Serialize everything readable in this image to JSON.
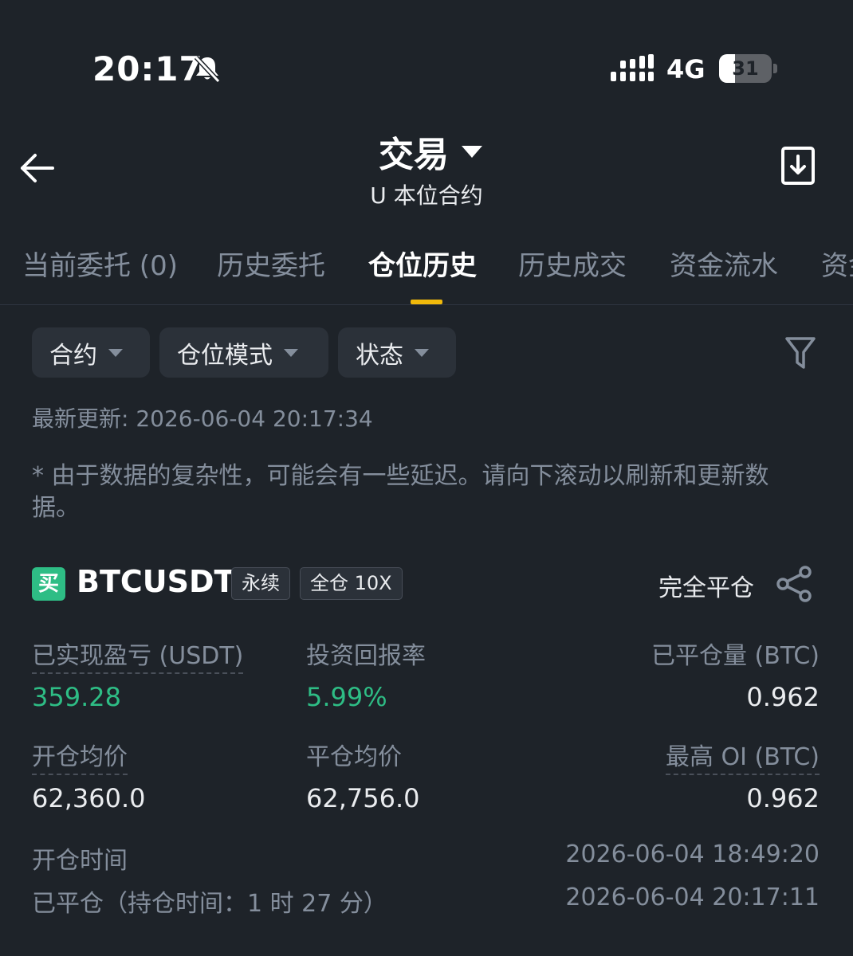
{
  "status_bar": {
    "time": "20:17",
    "network": "4G",
    "battery_level": "31",
    "battery_fraction": 0.31,
    "icons": [
      "bell-muted-icon",
      "signal-icon",
      "battery-icon"
    ]
  },
  "header": {
    "title": "交易",
    "subtitle": "U 本位合约",
    "icons": [
      "back-arrow-icon",
      "caret-down-icon",
      "download-icon"
    ]
  },
  "tabs": [
    {
      "label": "当前委托 (0)",
      "active": false
    },
    {
      "label": "历史委托",
      "active": false
    },
    {
      "label": "仓位历史",
      "active": true
    },
    {
      "label": "历史成交",
      "active": false
    },
    {
      "label": "资金流水",
      "active": false
    },
    {
      "label": "资金",
      "active": false
    }
  ],
  "filters": {
    "contract": "合约",
    "position_mode": "仓位模式",
    "status": "状态",
    "icon": "filter-icon"
  },
  "updated": "最新更新: 2026-06-04 20:17:34",
  "notice": "* 由于数据的复杂性，可能会有一些延迟。请向下滚动以刷新和更新数据。",
  "position": {
    "side_badge": "买",
    "symbol": "BTCUSDT",
    "tag_type": "永续",
    "tag_margin": "全仓 10X",
    "close_all": "完全平仓",
    "share_icon": "share-icon",
    "realized_pnl_label": "已实现盈亏 (USDT)",
    "realized_pnl": "359.28",
    "roi_label": "投资回报率",
    "roi": "5.99%",
    "closed_qty_label": "已平仓量 (BTC)",
    "closed_qty": "0.962",
    "entry_price_label": "开仓均价",
    "entry_price": "62,360.0",
    "close_price_label": "平仓均价",
    "close_price": "62,756.0",
    "max_oi_label": "最高 OI (BTC)",
    "max_oi": "0.962",
    "open_time_label": "开仓时间",
    "open_time": "2026-06-04 18:49:20",
    "closed_label": "已平仓（持仓时间：1 时 27 分）",
    "closed_time": "2026-06-04 20:17:11"
  },
  "colors": {
    "background": "#1e2329",
    "accent": "#f0b90b",
    "profit": "#2ebd85",
    "muted": "#848e9c"
  }
}
